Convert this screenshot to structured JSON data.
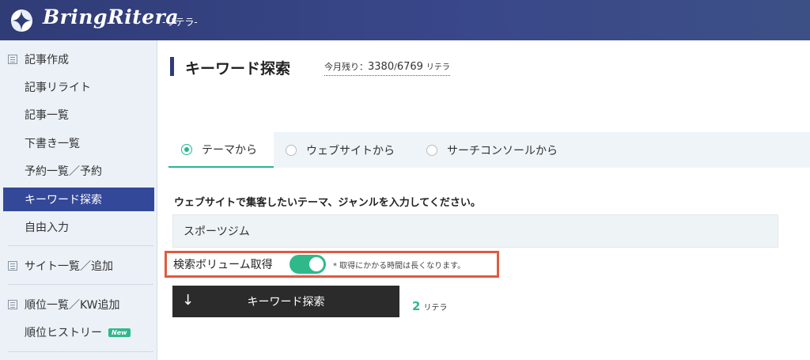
{
  "header": {
    "brand": "BringRitera",
    "brand_sub": "-リテラ-"
  },
  "sidebar": {
    "sections": [
      {
        "label": "記事作成",
        "items": [
          {
            "label": "記事リライト"
          },
          {
            "label": "記事一覧"
          },
          {
            "label": "下書き一覧"
          },
          {
            "label": "予約一覧／予約"
          },
          {
            "label": "キーワード探索",
            "active": true
          },
          {
            "label": "自由入力"
          }
        ]
      },
      {
        "label": "サイト一覧／追加",
        "items": []
      },
      {
        "label": "順位一覧／KW追加",
        "items": [
          {
            "label": "順位ヒストリー",
            "badge": "New"
          }
        ]
      }
    ]
  },
  "page": {
    "title": "キーワード探索",
    "quota_label": "今月残り：",
    "quota_remaining": "3380",
    "quota_sep": " / ",
    "quota_total": "6769",
    "quota_unit": "リテラ"
  },
  "tabs": [
    {
      "label": "テーマから",
      "selected": true
    },
    {
      "label": "ウェブサイトから",
      "selected": false
    },
    {
      "label": "サーチコンソールから",
      "selected": false
    }
  ],
  "form": {
    "instruction": "ウェブサイトで集客したいテーマ、ジャンルを入力してください。",
    "theme_value": "スポーツジム",
    "toggle_label": "検索ボリューム取得",
    "toggle_on": true,
    "toggle_note": "* 取得にかかる時間は長くなります。",
    "search_button_label": "キーワード探索",
    "cost_value": "2",
    "cost_unit": "リテラ"
  },
  "colors": {
    "header": "#303c76",
    "accent_green": "#2fb98a",
    "active_nav": "#34489a",
    "highlight_border": "#e15a3e"
  }
}
